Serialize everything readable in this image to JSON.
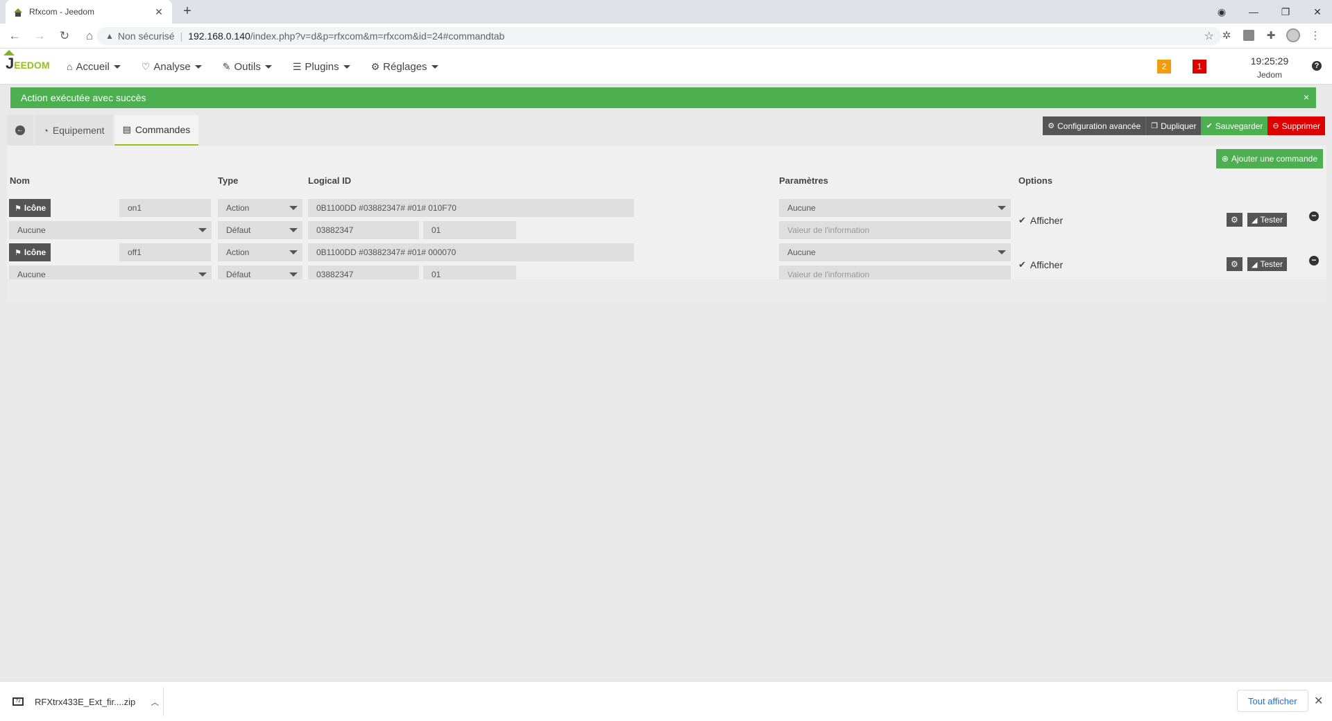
{
  "browser": {
    "tab_title": "Rfxcom - Jeedom",
    "tab_close": "✕",
    "new_tab": "+",
    "security_label": "Non sécurisé",
    "url_host": "192.168.0.140",
    "url_path": "/index.php?v=d&p=rfxcom&m=rfxcom&id=24#commandtab"
  },
  "nav": {
    "logo_j": "J",
    "logo_rest": "EEDOM",
    "menu": [
      {
        "label": "Accueil",
        "icon": "home-icon"
      },
      {
        "label": "Analyse",
        "icon": "stethoscope-icon"
      },
      {
        "label": "Outils",
        "icon": "wrench-icon"
      },
      {
        "label": "Plugins",
        "icon": "list-icon"
      },
      {
        "label": "Réglages",
        "icon": "gear-icon"
      }
    ],
    "badge_orange": "2",
    "badge_red": "1",
    "time": "19:25:29",
    "user": "Jedom",
    "help": "?"
  },
  "alert": {
    "message": "Action exécutée avec succès",
    "close": "×"
  },
  "tabs": {
    "equipement": "Equipement",
    "commandes": "Commandes"
  },
  "actions": {
    "config": "Configuration avancée",
    "duplicate": "Dupliquer",
    "save": "Sauvegarder",
    "delete": "Supprimer"
  },
  "table": {
    "add_command": "Ajouter une commande",
    "headers": {
      "nom": "Nom",
      "type": "Type",
      "logical_id": "Logical ID",
      "parametres": "Paramètres",
      "options": "Options"
    },
    "rows": [
      {
        "icon_label": "Icône",
        "name": "on1",
        "type": "Action",
        "logical_id": "0B1100DD #03882347# #01# 010F70",
        "param": "Aucune",
        "sub_select": "Aucune",
        "subtype": "Défaut",
        "id1": "03882347",
        "id2": "01",
        "info_placeholder": "Valeur de l'information",
        "afficher": "Afficher",
        "test": "Tester"
      },
      {
        "icon_label": "Icône",
        "name": "off1",
        "type": "Action",
        "logical_id": "0B1100DD #03882347# #01# 000070",
        "param": "Aucune",
        "sub_select": "Aucune",
        "subtype": "Défaut",
        "id1": "03882347",
        "id2": "01",
        "info_placeholder": "Valeur de l'information",
        "afficher": "Afficher",
        "test": "Tester"
      }
    ]
  },
  "downloads": {
    "file": "RFXtrx433E_Ext_fir....zip",
    "show_all": "Tout afficher"
  }
}
